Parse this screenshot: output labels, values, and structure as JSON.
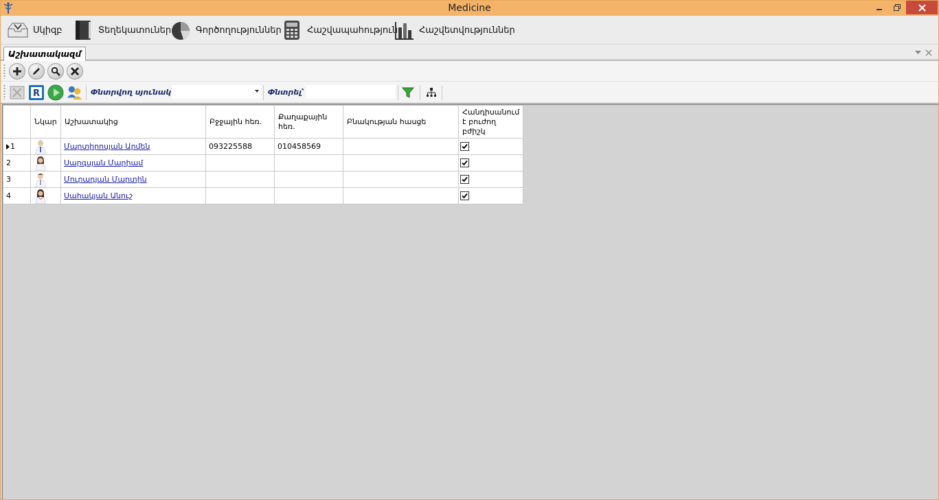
{
  "window": {
    "title": "Medicine",
    "accent_color": "#f3b46a",
    "close_color": "#c74a3a"
  },
  "menu": {
    "items": [
      {
        "label": "Սկիզբ",
        "icon": "inbox-tray-icon"
      },
      {
        "label": "Տեղեկատուներ",
        "icon": "book-icon"
      },
      {
        "label": "Գործողություններ",
        "icon": "pie-chart-icon"
      },
      {
        "label": "Հաշվապահություն",
        "icon": "calculator-icon"
      },
      {
        "label": "Հաշվետվություններ",
        "icon": "bar-chart-icon"
      }
    ]
  },
  "tabs": {
    "active": "Աշխատակազմ"
  },
  "toolbar1": {
    "buttons": [
      "add-icon",
      "edit-icon",
      "search-icon",
      "delete-icon"
    ]
  },
  "toolbar2": {
    "search_column_label": "Փնտրվող սյունակ՝",
    "search_column_value": "",
    "search_label": "Փնտրել՝",
    "search_value": "",
    "buttons": [
      "excel-export-icon",
      "refresh-icon",
      "play-icon",
      "users-icon",
      "filter-icon",
      "hierarchy-icon"
    ]
  },
  "grid": {
    "columns": [
      "",
      "Նկար",
      "Աշխատակից",
      "Բջջային հեռ.",
      "Քաղաքային հեռ.",
      "Բնակության հասցե",
      "Հանդիսանում է բուժող բժիշկ"
    ],
    "rows": [
      {
        "num": "1",
        "current": true,
        "name": "Մարտիրոսյան Արմեն",
        "mobile": "093225588",
        "phone": "010458569",
        "address": "",
        "is_doctor": true
      },
      {
        "num": "2",
        "current": false,
        "name": "Սարգսյան Մարիամ",
        "mobile": "",
        "phone": "",
        "address": "",
        "is_doctor": true
      },
      {
        "num": "3",
        "current": false,
        "name": "Մուրադյան Մարտին",
        "mobile": "",
        "phone": "",
        "address": "",
        "is_doctor": true
      },
      {
        "num": "4",
        "current": false,
        "name": "Սահակյան Անուշ",
        "mobile": "",
        "phone": "",
        "address": "",
        "is_doctor": true
      }
    ]
  }
}
